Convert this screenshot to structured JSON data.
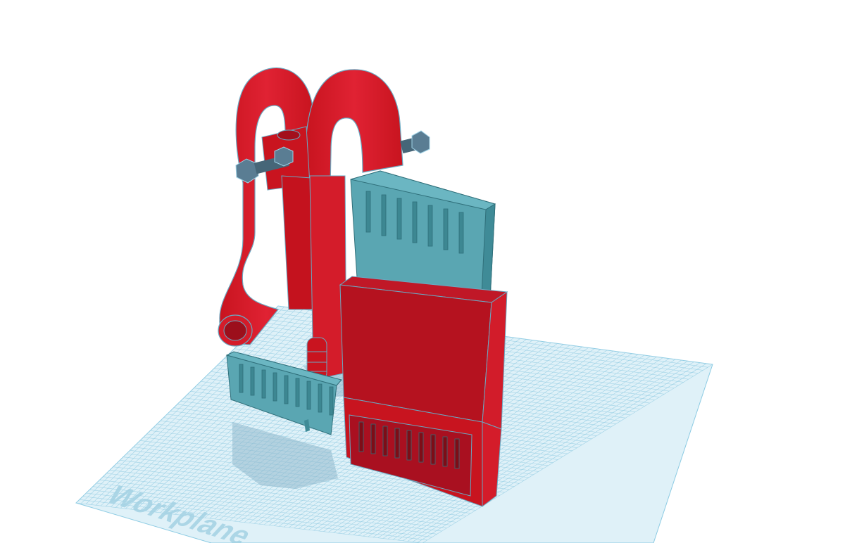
{
  "workplane": {
    "label": "Workplane",
    "grid_color": "#7fc4e0",
    "fill_color": "#dff1f8",
    "label_color": "#9fd0e4"
  },
  "model": {
    "primary_color": "#d41c2a",
    "shade_color": "#b0121e",
    "secondary_color": "#5aa7b3",
    "secondary_shade": "#3f8995",
    "bolt_color": "#4f6f84"
  }
}
